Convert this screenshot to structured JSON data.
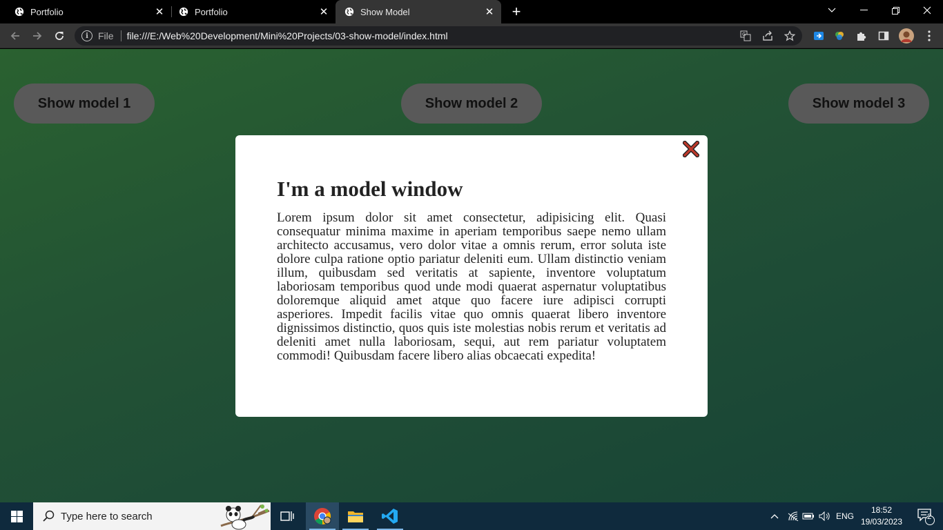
{
  "browser": {
    "tabs": [
      {
        "title": "Portfolio",
        "active": false
      },
      {
        "title": "Portfolio",
        "active": false
      },
      {
        "title": "Show Model",
        "active": true
      }
    ],
    "address": {
      "scheme": "File",
      "url": "file:///E:/Web%20Development/Mini%20Projects/03-show-model/index.html"
    }
  },
  "page": {
    "buttons": [
      "Show model 1",
      "Show model 2",
      "Show model 3"
    ],
    "modal": {
      "title": "I'm a model window",
      "body": "Lorem ipsum dolor sit amet consectetur, adipisicing elit. Quasi consequatur minima maxime in aperiam temporibus saepe nemo ullam architecto accusamus, vero dolor vitae a omnis rerum, error soluta iste dolore culpa ratione optio pariatur deleniti eum. Ullam distinctio veniam illum, quibusdam sed veritatis at sapiente, inventore voluptatum laboriosam temporibus quod unde modi quaerat aspernatur voluptatibus doloremque aliquid amet atque quo facere iure adipisci corrupti asperiores. Impedit facilis vitae quo omnis quaerat libero inventore dignissimos distinctio, quos quis iste molestias nobis rerum et veritatis ad deleniti amet nulla laboriosam, sequi, aut rem pariatur voluptatem commodi! Quibusdam facere libero alias obcaecati expedita!"
    }
  },
  "taskbar": {
    "search_placeholder": "Type here to search",
    "language": "ENG",
    "time": "18:52",
    "date": "19/03/2023",
    "notification_count": "2"
  },
  "colors": {
    "page_bg_start": "#2e6a35",
    "page_bg_end": "#1a4a3c",
    "button_bg": "#595959",
    "close_icon": "#c0392b"
  }
}
